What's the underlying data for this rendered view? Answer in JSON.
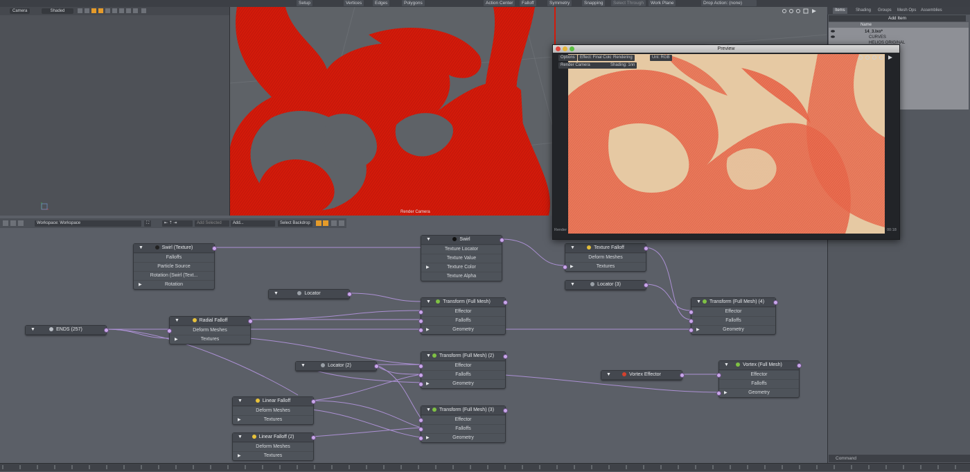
{
  "toolbar": {
    "items": [
      "Setup",
      "Vertices",
      "Edges",
      "Polygons",
      "Action Center",
      "Falloff",
      "Symmetry",
      "Snapping",
      "Select Through",
      "Work Plane",
      "Drop Action: (none)"
    ]
  },
  "left_viewport": {
    "camera_button": "Camera",
    "shading_button": "Shaded"
  },
  "main_viewport": {
    "label": "Render Camera"
  },
  "node_toolbar": {
    "workspace": "Workspace: Workspace",
    "add_selected": "Add Selected",
    "add": "Add...",
    "select_backdrop": "Select Backdrop"
  },
  "right_panel": {
    "tabs": [
      "Items",
      "Shading",
      "Groups",
      "Mesh Ops",
      "Assemblies"
    ],
    "add_item": "Add Item",
    "column_name": "Name",
    "items": [
      "14_3.lxo*",
      "CURVES",
      "HELIOS ORIGINAL"
    ],
    "command_placeholder": "Command"
  },
  "preview": {
    "title": "Preview",
    "toolbar": [
      "Options",
      "Effect: Final Color",
      "Rendering",
      "Unt: RGB",
      "Render Camera",
      "Shading: 1nn"
    ],
    "status_left": "Render",
    "status_right": "00:18"
  },
  "nodes": {
    "swirl_texture": {
      "title": "Swirl (Texture)",
      "rows": [
        "Falloffs",
        "Particle Source",
        "Rotation (Swirl (Text...",
        "Rotation"
      ]
    },
    "swirl": {
      "title": "Swirl",
      "rows": [
        "Texture Locator",
        "Texture Value",
        "Texture Color",
        "Texture Alpha"
      ]
    },
    "texture_falloff": {
      "title": "Texture Falloff",
      "rows": [
        "Deform Meshes",
        "Textures"
      ]
    },
    "locator": {
      "title": "Locator"
    },
    "locator3": {
      "title": "Locator (3)"
    },
    "transform1": {
      "title": "Transform (Full Mesh)",
      "rows": [
        "Effector",
        "Falloffs",
        "Geometry"
      ]
    },
    "transform4": {
      "title": "Transform (Full Mesh) (4)",
      "rows": [
        "Effector",
        "Falloffs",
        "Geometry"
      ]
    },
    "ends": {
      "title": "ENDS (257)"
    },
    "radial_falloff": {
      "title": "Radial Falloff",
      "rows": [
        "Deform Meshes",
        "Textures"
      ]
    },
    "locator2": {
      "title": "Locator (2)"
    },
    "transform2": {
      "title": "Transform (Full Mesh) (2)",
      "rows": [
        "Effector",
        "Falloffs",
        "Geometry"
      ]
    },
    "vortex_effector": {
      "title": "Vortex Effector"
    },
    "vortex": {
      "title": "Vortex (Full Mesh)",
      "rows": [
        "Effector",
        "Falloffs",
        "Geometry"
      ]
    },
    "linear_falloff": {
      "title": "Linear Falloff",
      "rows": [
        "Deform Meshes",
        "Textures"
      ]
    },
    "transform3": {
      "title": "Transform (Full Mesh) (3)",
      "rows": [
        "Effector",
        "Falloffs",
        "Geometry"
      ]
    },
    "linear_falloff2": {
      "title": "Linear Falloff (2)",
      "rows": [
        "Deform Meshes",
        "Textures"
      ]
    }
  },
  "colors": {
    "mesh_red": "#d31a0a",
    "render_bg": "#e6c9a3",
    "render_mesh": "#e8553a",
    "wire": "#b596e0"
  }
}
